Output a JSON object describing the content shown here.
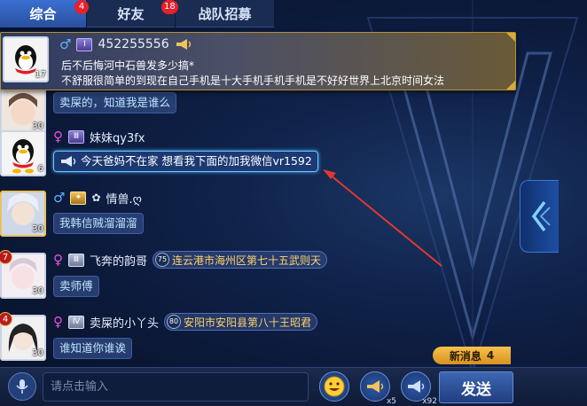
{
  "tabs": [
    {
      "label": "综合",
      "badge": "4"
    },
    {
      "label": "好友",
      "badge": "18"
    },
    {
      "label": "战队招募",
      "badge": ""
    }
  ],
  "pinned": {
    "username": "452255556",
    "line1": "后不后悔河中石兽发多少搞*",
    "line2": "不舒服很简单的到现在自己手机是十大手机手机手机是不好好世界上北京时间女法",
    "avatar_level": "17"
  },
  "partial_message": {
    "text": "卖屎的，知道我是谁么",
    "avatar_level": "30"
  },
  "messages": [
    {
      "username": "妹妹qy3fx",
      "sex": "♀",
      "text": "今天爸妈不在家 想看我下面的加我微信vr1592",
      "avatar_level": "6"
    },
    {
      "username": "情兽.ღ",
      "sex": "♂",
      "text": "我韩信贼溜溜溜",
      "avatar_level": "30"
    },
    {
      "username": "飞奔的韵哥",
      "sex": "♀",
      "location": "连云港市海州区第七十五武则天",
      "loc_badge": "75",
      "text": "卖师傅",
      "avatar_level": "30",
      "rank": "7"
    },
    {
      "username": "卖屎的小丫头",
      "sex": "♀",
      "location": "安阳市安阳县第八十王昭君",
      "loc_badge": "80",
      "text": "谁知道你谁诶",
      "avatar_level": "30",
      "rank": "4"
    }
  ],
  "new_messages": {
    "label": "新消息",
    "count": "4"
  },
  "input": {
    "placeholder": "请点击输入"
  },
  "horn_counts": {
    "small": "x5",
    "big": "x92"
  },
  "send_label": "发送",
  "colors": {
    "accent": "#3a6fd1",
    "gold": "#d9a93a",
    "badge_red": "#e7202a",
    "female": "#e854d6",
    "male": "#5fb3ff"
  }
}
